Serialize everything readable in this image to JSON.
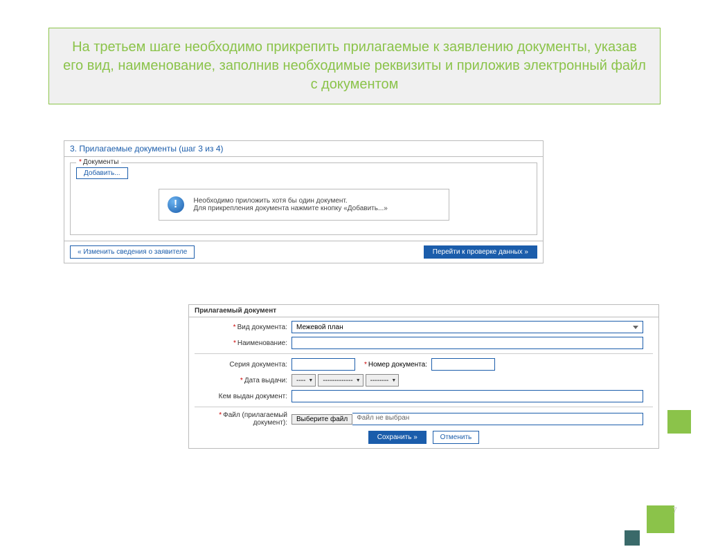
{
  "slide": {
    "title": "На третьем шаге необходимо прикрепить прилагаемые к заявлению документы, указав его вид, наименование, заполнив необходимые реквизиты и приложив электронный файл с документом",
    "page_number": "7"
  },
  "step_panel": {
    "header": "3. Прилагаемые документы (шаг 3 из 4)",
    "docs_legend": "Документы",
    "add_btn": "Добавить...",
    "info_line1": "Необходимо приложить хотя бы один документ.",
    "info_line2": "Для прикрепления документа нажмите кнопку «Добавить...»",
    "back_btn": "« Изменить сведения о заявителе",
    "next_btn": "Перейти к проверке данных »"
  },
  "doc_form": {
    "header": "Прилагаемый документ",
    "labels": {
      "type": "Вид документа:",
      "name": "Наименование:",
      "series": "Серия документа:",
      "number": "Номер документа:",
      "date": "Дата выдачи:",
      "issued_by": "Кем выдан документ:",
      "file": "Файл (прилагаемый документ):"
    },
    "type_value": "Межевой план",
    "date_selects": {
      "day": "----",
      "month": "-------------",
      "year": "--------"
    },
    "file_btn": "Выберите файл",
    "file_status": "Файл не выбран",
    "save_btn": "Сохранить »",
    "cancel_btn": "Отменить"
  }
}
